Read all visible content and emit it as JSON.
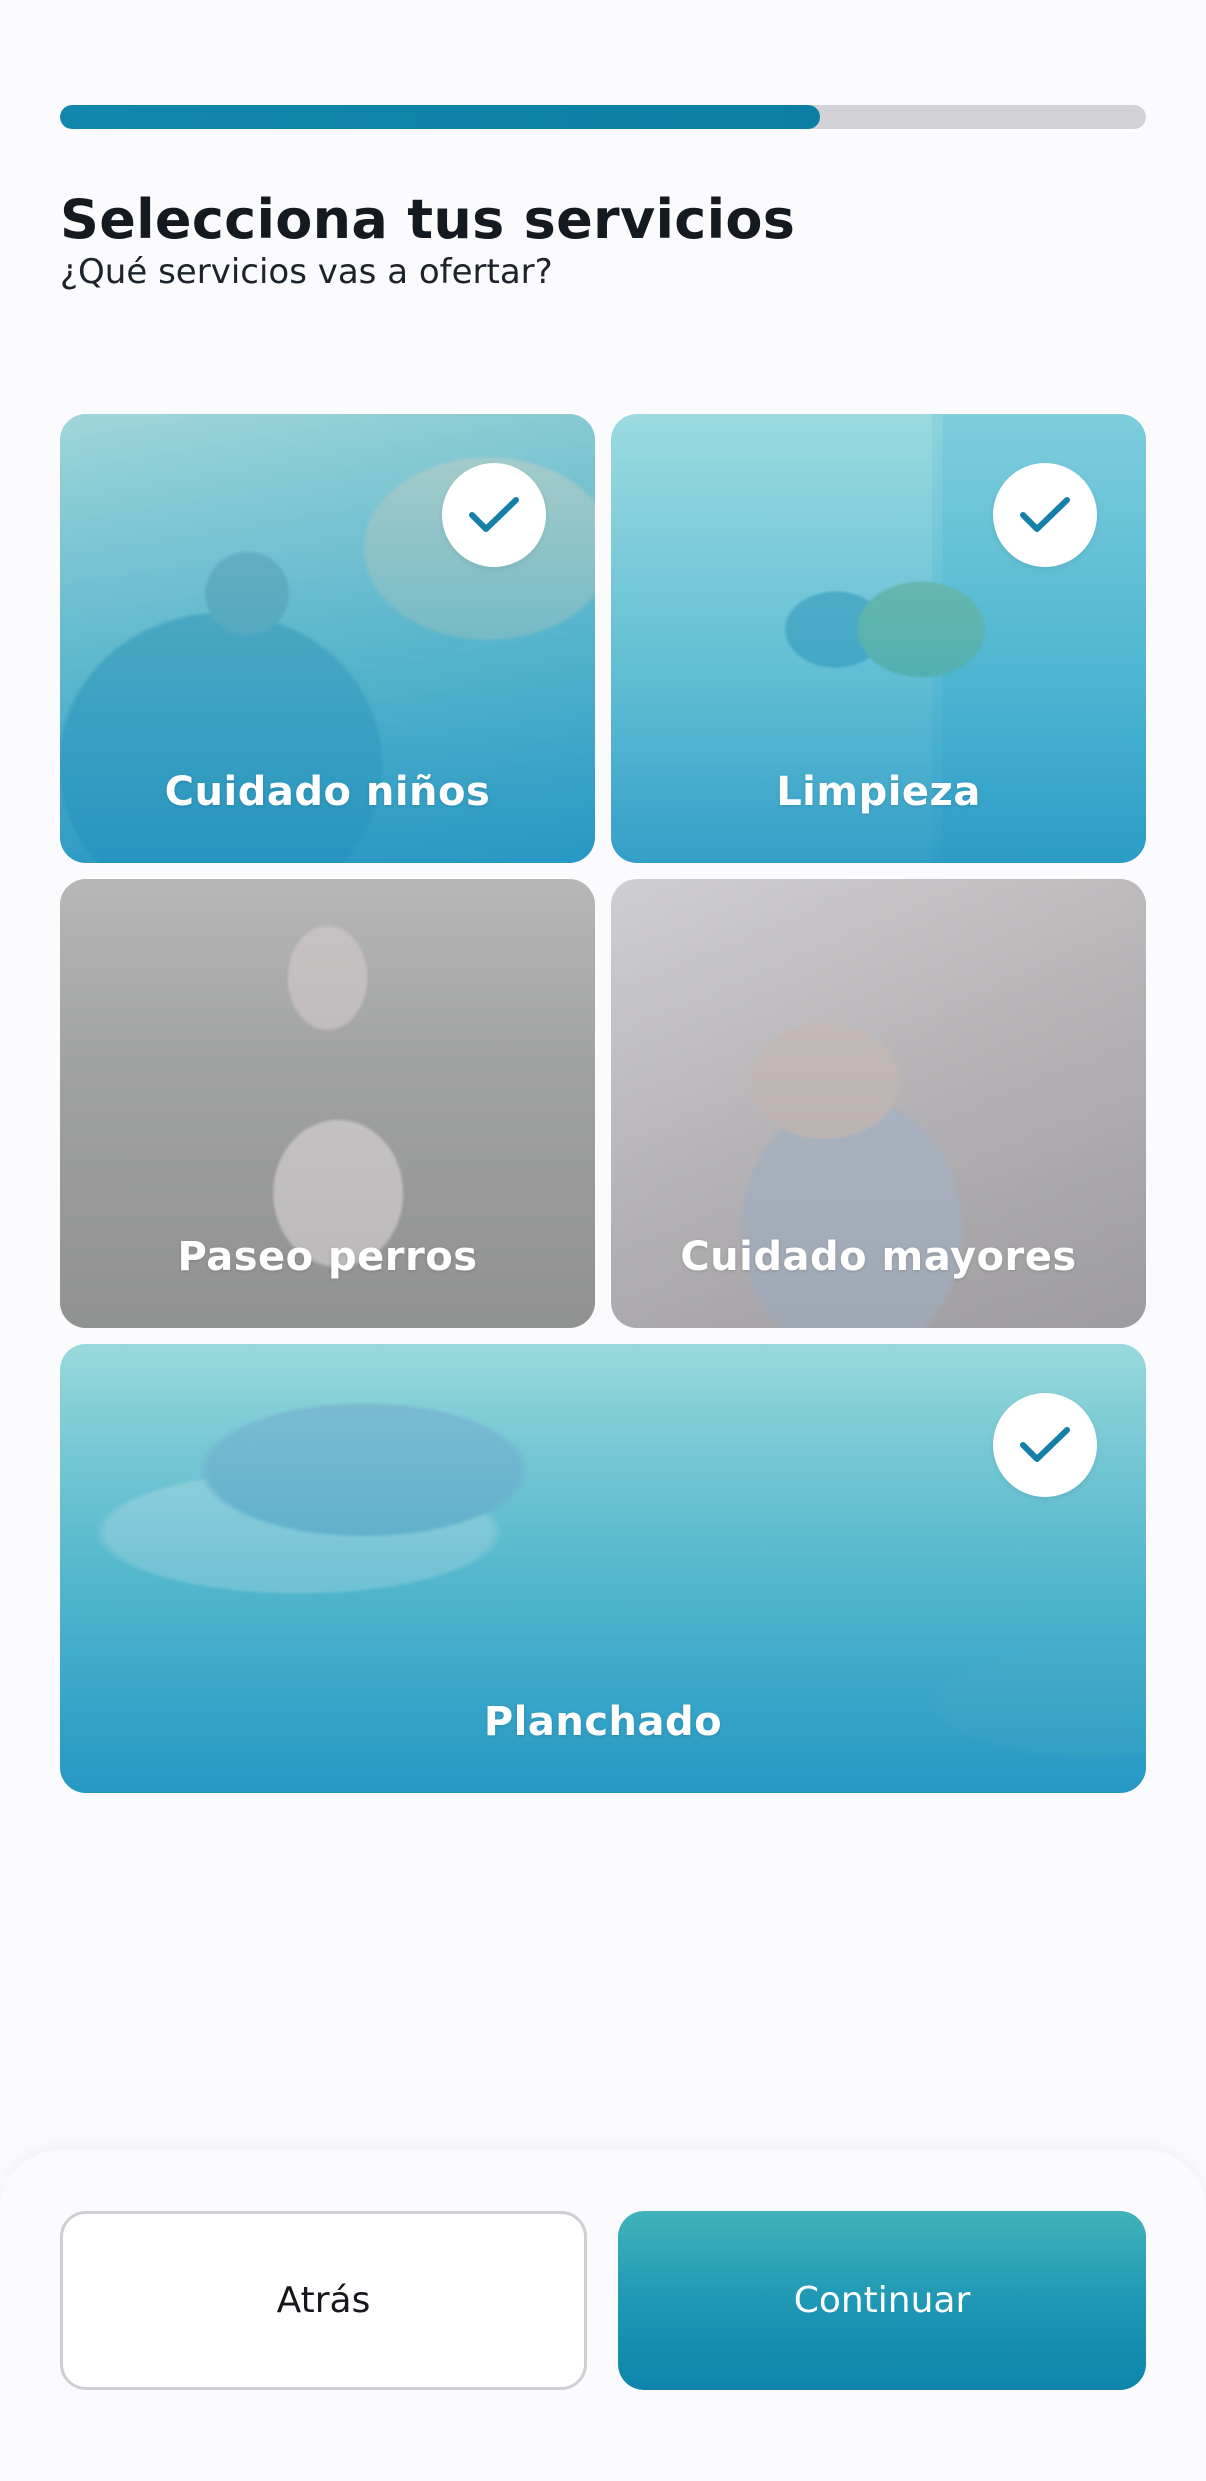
{
  "progress": {
    "value": 0.7
  },
  "header": {
    "title": "Selecciona tus servicios",
    "subtitle": "¿Qué servicios vas a ofertar?"
  },
  "services": [
    {
      "label": "Cuidado niños",
      "selected": true,
      "photo": "children-drawing-photo"
    },
    {
      "label": "Limpieza",
      "selected": true,
      "photo": "gloved-hand-cleaning-photo"
    },
    {
      "label": "Paseo perros",
      "selected": false,
      "photo": "dog-walking-photo"
    },
    {
      "label": "Cuidado mayores",
      "selected": false,
      "photo": "elderly-care-photo"
    },
    {
      "label": "Planchado",
      "selected": true,
      "photo": "ironing-photo"
    }
  ],
  "buttons": {
    "back_label": "Atrás",
    "continue_label": "Continuar"
  },
  "colors": {
    "accent": "#0D84AB",
    "progress_track": "#D3D3D5",
    "title_text": "#151A20",
    "check_icon": "#147FA8"
  },
  "icons": {
    "selected_badge": "check-icon"
  }
}
